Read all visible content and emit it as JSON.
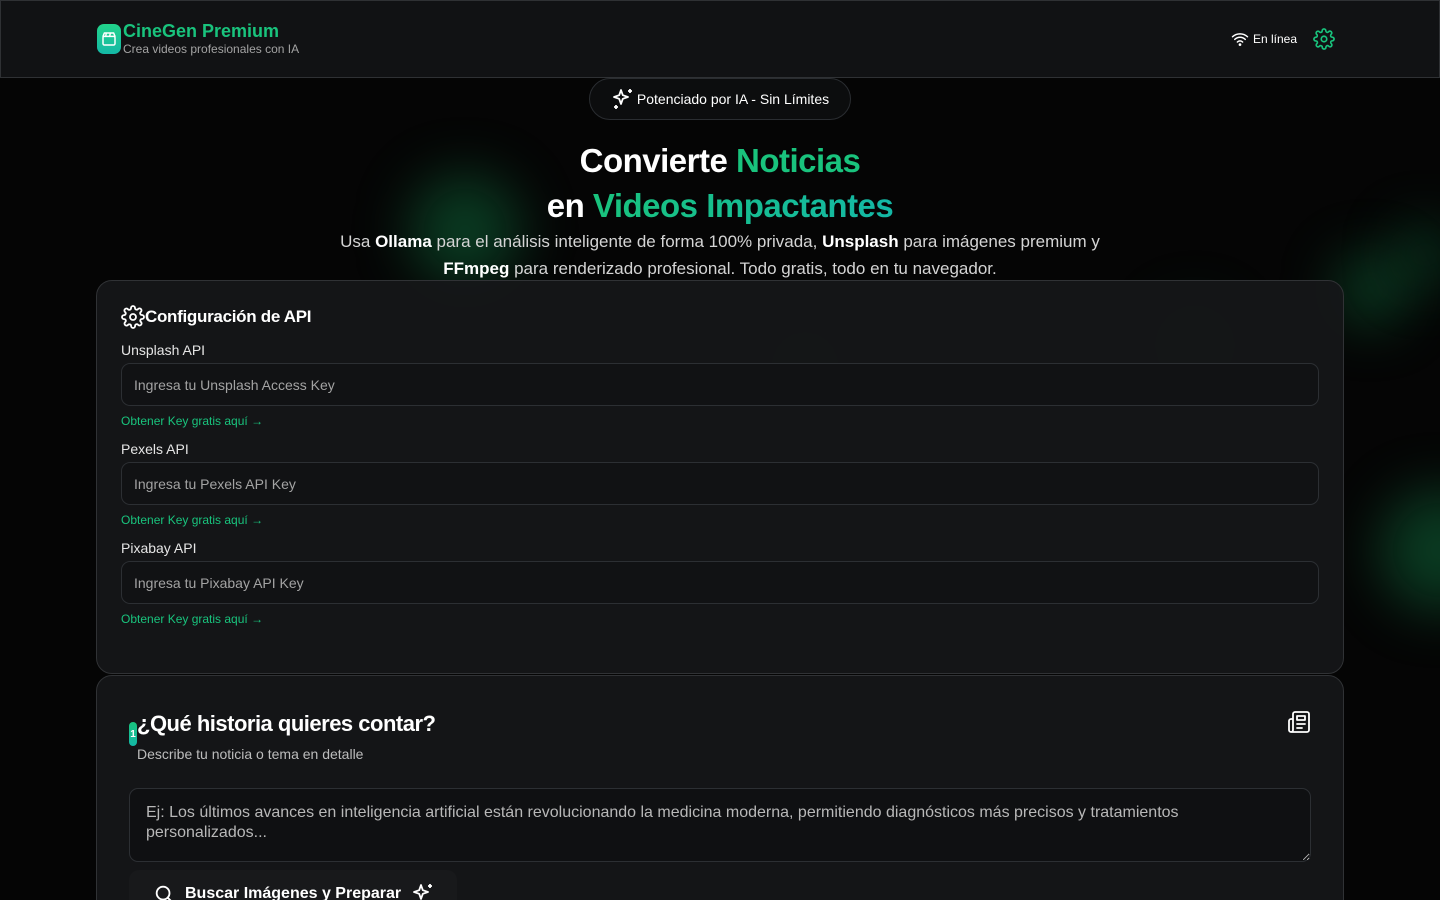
{
  "header": {
    "title": "CineGen Premium",
    "subtitle": "Crea videos profesionales con IA",
    "status": "En línea",
    "logo_icon": "clapperboard-icon",
    "status_icon": "wifi-icon",
    "settings_icon": "gear-icon"
  },
  "badge": {
    "label": "Potenciado por IA - Sin Límites",
    "icon": "sparkles-icon"
  },
  "hero": {
    "line1_plain": "Convierte ",
    "line1_accent": "Noticias",
    "line2_plain": "en ",
    "line2_accent": "Videos Impactantes",
    "desc": {
      "p1": "Usa ",
      "b1": "Ollama",
      "p2": " para el análisis inteligente de forma 100% privada, ",
      "b2": "Unsplash",
      "p3": " para imágenes premium y ",
      "b3": "FFmpeg",
      "p4": " para renderizado profesional. Todo gratis, todo en tu navegador."
    }
  },
  "api_config": {
    "title": "Configuración de API",
    "fields": [
      {
        "label": "Unsplash API",
        "placeholder": "Ingresa tu Unsplash Access Key",
        "link": "Obtener Key gratis aquí →"
      },
      {
        "label": "Pexels API",
        "placeholder": "Ingresa tu Pexels API Key",
        "link": "Obtener Key gratis aquí →"
      },
      {
        "label": "Pixabay API",
        "placeholder": "Ingresa tu Pixabay API Key",
        "link": "Obtener Key gratis aquí →"
      }
    ]
  },
  "story": {
    "step": "1",
    "title": "¿Qué historia quieres contar?",
    "subtitle": "Describe tu noticia o tema en detalle",
    "placeholder": "Ej: Los últimos avances en inteligencia artificial están revolucionando la medicina moderna, permitiendo diagnósticos más precisos y tratamientos personalizados...",
    "button": "Buscar Imágenes y Preparar",
    "news_icon": "newspaper-icon",
    "search_icon": "search-icon"
  },
  "colors": {
    "accent": "#19c37d",
    "accent2": "#14b8a6",
    "background": "#050505",
    "card": "#161719"
  }
}
